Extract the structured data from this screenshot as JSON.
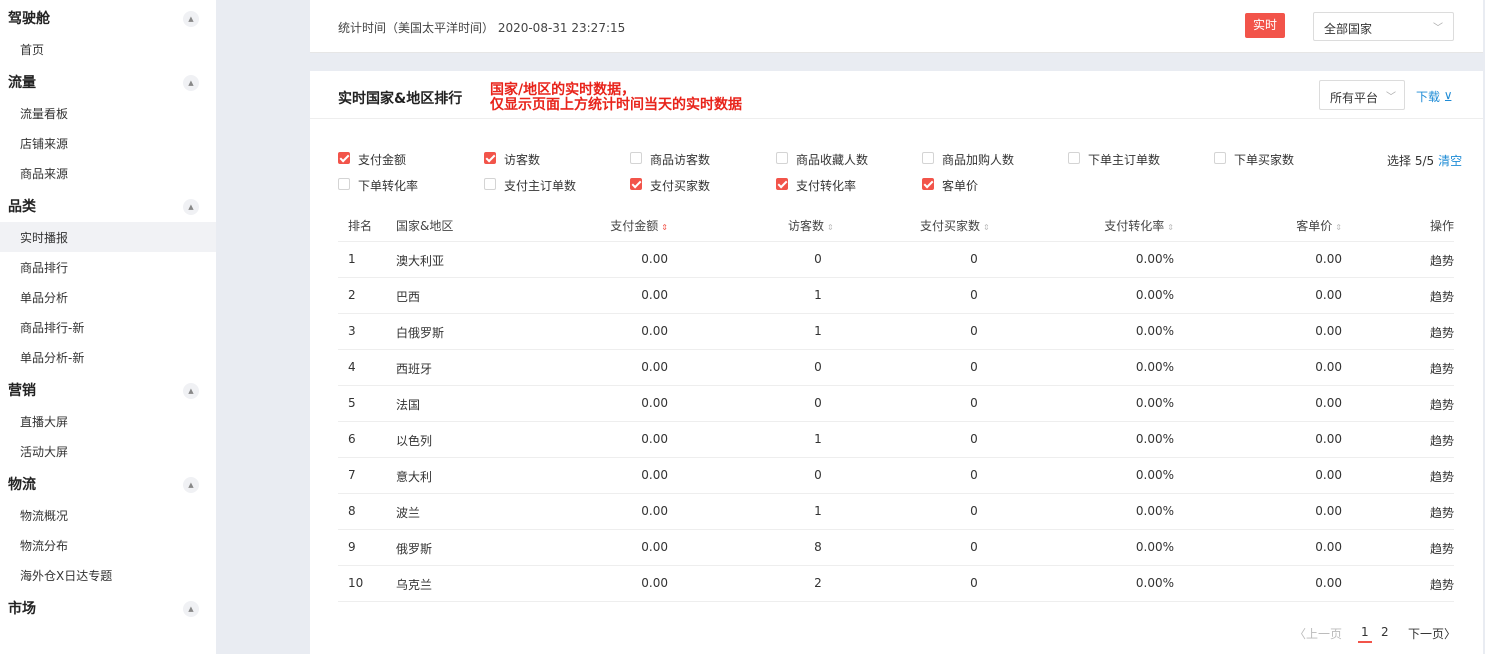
{
  "sidebar": {
    "groups": [
      {
        "label": "驾驶舱",
        "items": [
          "首页"
        ]
      },
      {
        "label": "流量",
        "items": [
          "流量看板",
          "店铺来源",
          "商品来源"
        ]
      },
      {
        "label": "品类",
        "items": [
          "实时播报",
          "商品排行",
          "单品分析",
          "商品排行-新",
          "单品分析-新"
        ]
      },
      {
        "label": "营销",
        "items": [
          "直播大屏",
          "活动大屏"
        ]
      },
      {
        "label": "物流",
        "items": [
          "物流概况",
          "物流分布",
          "海外仓X日达专题"
        ]
      },
      {
        "label": "市场",
        "items": []
      }
    ],
    "active_item": "实时播报",
    "toggle_glyph": "▲"
  },
  "topbar": {
    "stat_time": "统计时间（美国太平洋时间） 2020-08-31 23:27:15",
    "realtime_label": "实时",
    "country_select": "全部国家",
    "chevron": "﹀"
  },
  "main": {
    "title": "实时国家&地区排行",
    "annotation_line1": "国家/地区的实时数据，",
    "annotation_line2": "仅显示页面上方统计时间当天的实时数据",
    "platform_select": "所有平台",
    "download_label": "下载 ⊻",
    "checkboxes": [
      {
        "label": "支付金额",
        "checked": true
      },
      {
        "label": "访客数",
        "checked": true
      },
      {
        "label": "商品访客数",
        "checked": false
      },
      {
        "label": "商品收藏人数",
        "checked": false
      },
      {
        "label": "商品加购人数",
        "checked": false
      },
      {
        "label": "下单主订单数",
        "checked": false
      },
      {
        "label": "下单买家数",
        "checked": false
      },
      {
        "label": "下单转化率",
        "checked": false
      },
      {
        "label": "支付主订单数",
        "checked": false
      },
      {
        "label": "支付买家数",
        "checked": true
      },
      {
        "label": "支付转化率",
        "checked": true
      },
      {
        "label": "客单价",
        "checked": true
      }
    ],
    "select_count": "选择 5/5",
    "clear_label": "清空",
    "table": {
      "headers": {
        "rank": "排名",
        "country": "国家&地区",
        "pay": "支付金额",
        "visitors": "访客数",
        "buyers": "支付买家数",
        "conversion": "支付转化率",
        "avg": "客单价",
        "action": "操作"
      },
      "sort_glyph": "⇕",
      "rows": [
        {
          "rank": "1",
          "country": "澳大利亚",
          "pay": "0.00",
          "visitors": "0",
          "buyers": "0",
          "conversion": "0.00%",
          "avg": "0.00",
          "action": "趋势"
        },
        {
          "rank": "2",
          "country": "巴西",
          "pay": "0.00",
          "visitors": "1",
          "buyers": "0",
          "conversion": "0.00%",
          "avg": "0.00",
          "action": "趋势"
        },
        {
          "rank": "3",
          "country": "白俄罗斯",
          "pay": "0.00",
          "visitors": "1",
          "buyers": "0",
          "conversion": "0.00%",
          "avg": "0.00",
          "action": "趋势"
        },
        {
          "rank": "4",
          "country": "西班牙",
          "pay": "0.00",
          "visitors": "0",
          "buyers": "0",
          "conversion": "0.00%",
          "avg": "0.00",
          "action": "趋势"
        },
        {
          "rank": "5",
          "country": "法国",
          "pay": "0.00",
          "visitors": "0",
          "buyers": "0",
          "conversion": "0.00%",
          "avg": "0.00",
          "action": "趋势"
        },
        {
          "rank": "6",
          "country": "以色列",
          "pay": "0.00",
          "visitors": "1",
          "buyers": "0",
          "conversion": "0.00%",
          "avg": "0.00",
          "action": "趋势"
        },
        {
          "rank": "7",
          "country": "意大利",
          "pay": "0.00",
          "visitors": "0",
          "buyers": "0",
          "conversion": "0.00%",
          "avg": "0.00",
          "action": "趋势"
        },
        {
          "rank": "8",
          "country": "波兰",
          "pay": "0.00",
          "visitors": "1",
          "buyers": "0",
          "conversion": "0.00%",
          "avg": "0.00",
          "action": "趋势"
        },
        {
          "rank": "9",
          "country": "俄罗斯",
          "pay": "0.00",
          "visitors": "8",
          "buyers": "0",
          "conversion": "0.00%",
          "avg": "0.00",
          "action": "趋势"
        },
        {
          "rank": "10",
          "country": "乌克兰",
          "pay": "0.00",
          "visitors": "2",
          "buyers": "0",
          "conversion": "0.00%",
          "avg": "0.00",
          "action": "趋势"
        }
      ]
    },
    "pager": {
      "prev": "〈上一页",
      "page1": "1",
      "page2": "2",
      "next": "下一页〉"
    }
  },
  "colors": {
    "accent_red": "#f2544a",
    "link_blue": "#1f8cd6",
    "annotation_red": "#e8231a"
  }
}
